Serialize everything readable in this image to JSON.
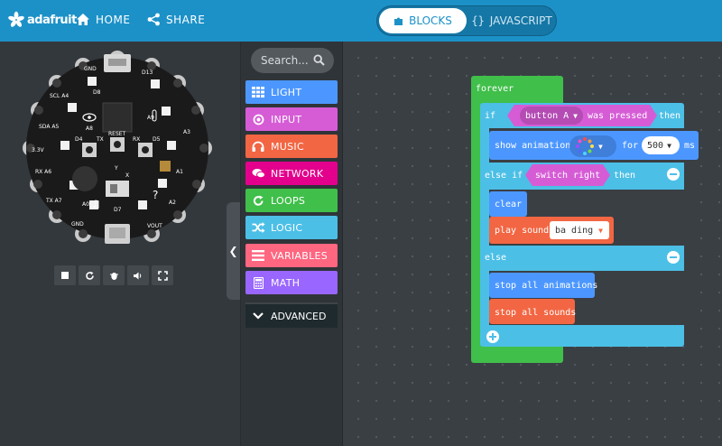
{
  "header": {
    "logo_text": "adafruit",
    "home_label": "HOME",
    "share_label": "SHARE",
    "blocks_label": "BLOCKS",
    "javascript_label": "JAVASCRIPT"
  },
  "simulator": {
    "board_labels": {
      "gnd_top": "GND",
      "d13": "D13",
      "d8": "D8",
      "a8": "A8",
      "a9": "A9",
      "d4": "D4",
      "tx": "TX",
      "reset": "RESET",
      "rx": "RX",
      "d5": "D5",
      "d7": "D7",
      "a0": "A0",
      "scl_a4": "SCL A4",
      "sda_a5": "SDA A5",
      "tx_a7": "TX A7",
      "rx_a6": "RX A6",
      "a1": "A1",
      "a2": "A2",
      "a3": "A3",
      "pin_3v3": "3.3V",
      "pin_vout": "VOUT",
      "gnd_bottom": "GND",
      "y_label": "Y",
      "x_label": "X"
    },
    "controls": [
      "stop-icon",
      "restart-icon",
      "debug-icon",
      "mute-icon",
      "fullscreen-icon"
    ]
  },
  "toolbox": {
    "search_placeholder": "Search...",
    "categories": [
      {
        "label": "LIGHT",
        "color": "#4c97ff",
        "icon": "grid-icon"
      },
      {
        "label": "INPUT",
        "color": "#d65cd6",
        "icon": "target-icon"
      },
      {
        "label": "MUSIC",
        "color": "#f26643",
        "icon": "headphones-icon"
      },
      {
        "label": "NETWORK",
        "color": "#e3008c",
        "icon": "chat-icon"
      },
      {
        "label": "LOOPS",
        "color": "#40bf4a",
        "icon": "loop-icon"
      },
      {
        "label": "LOGIC",
        "color": "#4cbfe6",
        "icon": "shuffle-icon"
      },
      {
        "label": "VARIABLES",
        "color": "#ff6680",
        "icon": "list-icon"
      },
      {
        "label": "MATH",
        "color": "#9966ff",
        "icon": "calculator-icon"
      }
    ],
    "advanced_label": "ADVANCED"
  },
  "workspace": {
    "forever": "forever",
    "if": "if",
    "button_a": "button A",
    "was_pressed": "was pressed",
    "then1": "then",
    "show_animation": "show animation",
    "for": "for",
    "duration": "500",
    "ms": "ms",
    "else_if": "else if",
    "switch_right": "switch right",
    "then2": "then",
    "clear": "clear",
    "play_sound": "play sound",
    "sound_name": "ba ding",
    "else": "else",
    "stop_all_animations": "stop all animations",
    "stop_all_sounds": "stop all sounds"
  }
}
